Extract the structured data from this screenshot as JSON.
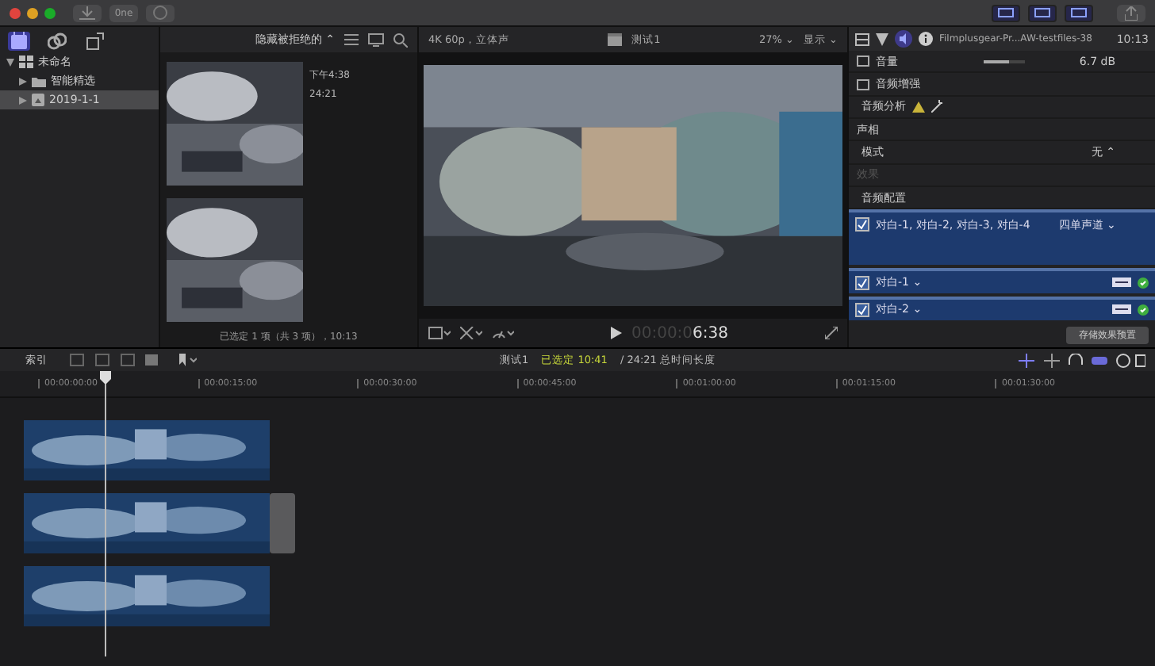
{
  "toolbar": {
    "buttons": [
      {
        "kind": "import"
      },
      {
        "kind": "keyword",
        "label": "0ne"
      },
      {
        "kind": "background"
      }
    ],
    "workspace_buttons": [
      {
        "selected": true
      },
      {
        "selected": true
      },
      {
        "selected": true
      }
    ]
  },
  "sidebar": {
    "tabs": [
      {
        "kind": "library",
        "selected": true
      },
      {
        "kind": "photos",
        "selected": false
      },
      {
        "kind": "titles",
        "selected": false
      }
    ],
    "items": [
      {
        "label": "未命名",
        "kind": "library",
        "expanded": true,
        "selected": false,
        "children": [
          {
            "label": "智能精选",
            "kind": "folder",
            "expanded": false,
            "selected": false
          },
          {
            "label": "2019-1-1",
            "kind": "event",
            "expanded": false,
            "selected": true
          }
        ]
      }
    ]
  },
  "browser": {
    "filter": "隐藏被拒绝的 ⌃",
    "clips": [
      {
        "kind": "picture",
        "date": "下午4:38",
        "duration": "24:21"
      },
      {
        "kind": "picture"
      }
    ],
    "status": "已选定 1 项（共 3 项），10:13"
  },
  "viewer": {
    "format": "4K 60p，立体声",
    "title": "测试1",
    "zoom": "27% ⌄",
    "display": "显示 ⌄",
    "timecode_dim": "00:00:0",
    "timecode": "6:38"
  },
  "inspector": {
    "clip_name": "Filmplusgear-Pr...AW-testfiles-38",
    "duration": "10:13",
    "rows": [
      {
        "kind": "slider",
        "label": "音量",
        "level": 0.6,
        "value": "6.7 dB"
      },
      {
        "kind": "section",
        "label": "音频增强"
      },
      {
        "kind": "analysis",
        "label": "音频分析"
      },
      {
        "kind": "section",
        "label": "声相"
      },
      {
        "kind": "popup",
        "label": "模式",
        "value": "无 ⌃"
      },
      {
        "kind": "disabled",
        "label": "效果"
      },
      {
        "kind": "heading",
        "label": "音频配置"
      }
    ],
    "channels": [
      {
        "label": "对白-1, 对白-2, 对白-3, 对白-4",
        "mode": "四单声道 ⌄",
        "checked": true
      },
      {
        "label": "对白-1 ⌄",
        "checked": true
      },
      {
        "label": "对白-2 ⌄",
        "checked": true
      }
    ],
    "save_button": "存储效果预置"
  },
  "timeline": {
    "index": "索引",
    "title": "测试1",
    "selected": "已选定 10:41",
    "total": "/ 24:21 总时间长度",
    "ticks": [
      "00:00:00:00",
      "00:00:15:00",
      "00:00:30:00",
      "00:00:45:00",
      "00:01:00:00",
      "00:01:15:00",
      "00:01:30:00"
    ],
    "clips": [
      {
        "kind": "picture"
      },
      {
        "kind": "picture"
      },
      {
        "kind": "picture"
      }
    ]
  }
}
